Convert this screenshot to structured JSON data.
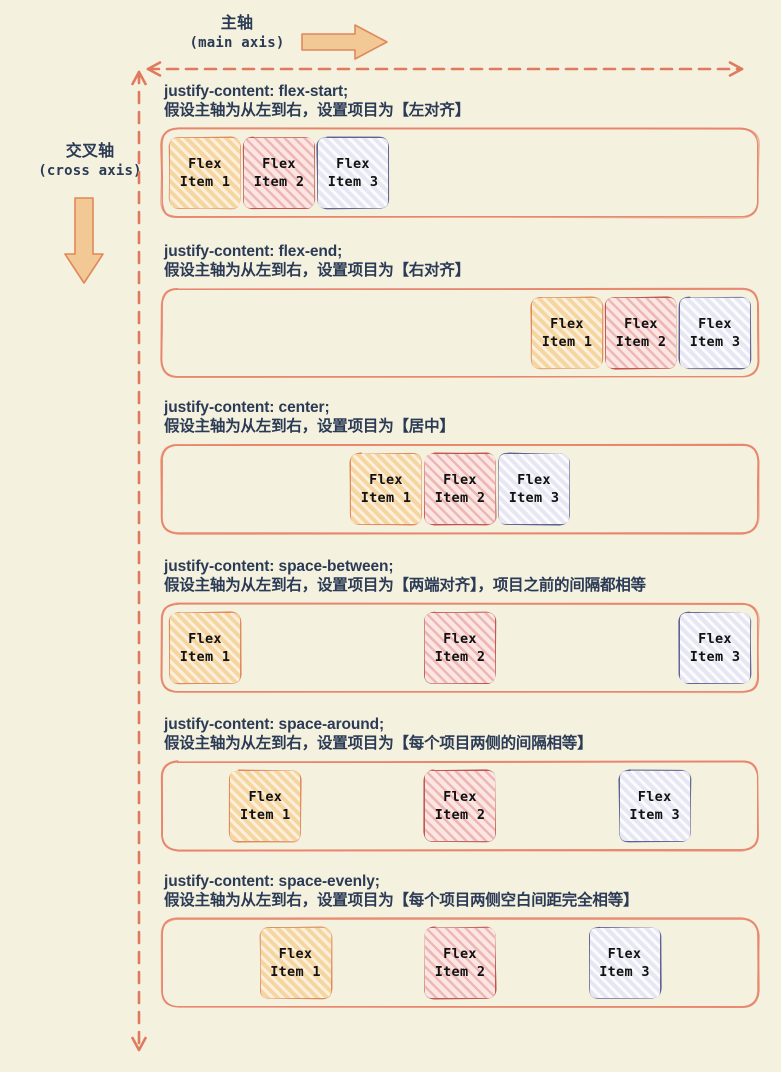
{
  "page": {
    "background_color": "#f4f1de",
    "text_color": "#2b3a55"
  },
  "axes": {
    "main": {
      "cn": "主轴",
      "en": "(main axis)",
      "arrow_icon": "arrow-right-icon",
      "arrow_color": "#f2c894",
      "line_color": "#e07a5f",
      "line_style": "dashed"
    },
    "cross": {
      "cn": "交叉轴",
      "en": "(cross axis)",
      "arrow_icon": "arrow-down-icon",
      "arrow_color": "#f2c894",
      "line_color": "#e07a5f",
      "line_style": "dashed"
    }
  },
  "item_labels": {
    "line1": "Flex",
    "item1_line2": "Item 1",
    "item2_line2": "Item 2",
    "item3_line2": "Item 3"
  },
  "item_colors": {
    "item1_border": "#e0885a",
    "item1_fill": "#f6d6a0",
    "item2_border": "#c0504d",
    "item2_fill": "#fbe6e4",
    "item3_border": "#5c5f94",
    "item3_fill": "#e6e7f2",
    "container_border": "#e8846a"
  },
  "sections": [
    {
      "id": "flex-start",
      "property": "justify-content: flex-start;",
      "description": "假设主轴为从左到右，设置项目为【左对齐】",
      "justify": "flex-start"
    },
    {
      "id": "flex-end",
      "property": "justify-content: flex-end;",
      "description": "假设主轴为从左到右，设置项目为【右对齐】",
      "justify": "flex-end"
    },
    {
      "id": "center",
      "property": "justify-content: center;",
      "description": "假设主轴为从左到右，设置项目为【居中】",
      "justify": "center"
    },
    {
      "id": "space-between",
      "property": "justify-content: space-between;",
      "description": "假设主轴为从左到右，设置项目为【两端对齐】，项目之前的间隔都相等",
      "justify": "space-between"
    },
    {
      "id": "space-around",
      "property": "justify-content: space-around;",
      "description": "假设主轴为从左到右，设置项目为【每个项目两侧的间隔相等】",
      "justify": "space-around"
    },
    {
      "id": "space-evenly",
      "property": "justify-content: space-evenly;",
      "description": "假设主轴为从左到右，设置项目为【每个项目两侧空白间距完全相等】",
      "justify": "space-evenly"
    }
  ]
}
